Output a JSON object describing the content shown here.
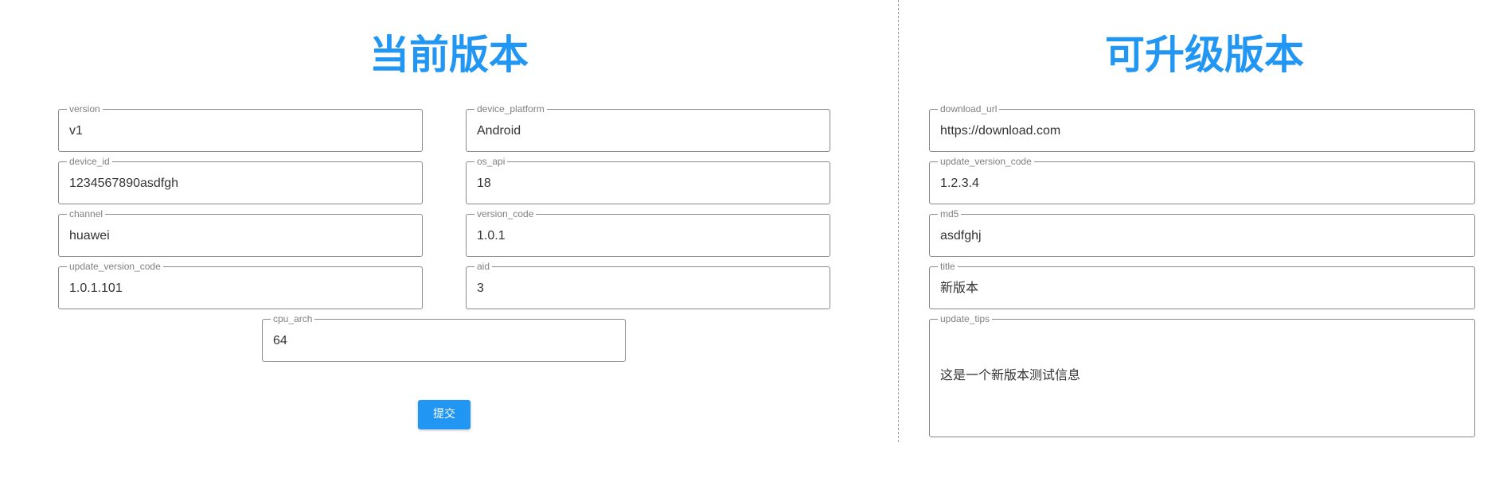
{
  "current": {
    "title": "当前版本",
    "fields": {
      "version": {
        "label": "version",
        "value": "v1"
      },
      "device_platform": {
        "label": "device_platform",
        "value": "Android"
      },
      "device_id": {
        "label": "device_id",
        "value": "1234567890asdfgh"
      },
      "os_api": {
        "label": "os_api",
        "value": "18"
      },
      "channel": {
        "label": "channel",
        "value": "huawei"
      },
      "version_code": {
        "label": "version_code",
        "value": "1.0.1"
      },
      "update_version_code": {
        "label": "update_version_code",
        "value": "1.0.1.101"
      },
      "aid": {
        "label": "aid",
        "value": "3"
      },
      "cpu_arch": {
        "label": "cpu_arch",
        "value": "64"
      }
    },
    "submit_label": "提交"
  },
  "upgrade": {
    "title": "可升级版本",
    "fields": {
      "download_url": {
        "label": "download_url",
        "value": "https://download.com"
      },
      "update_version_code": {
        "label": "update_version_code",
        "value": "1.2.3.4"
      },
      "md5": {
        "label": "md5",
        "value": "asdfghj"
      },
      "title": {
        "label": "title",
        "value": "新版本"
      },
      "update_tips": {
        "label": "update_tips",
        "value": "这是一个新版本测试信息"
      }
    }
  },
  "colors": {
    "accent": "#2196f3",
    "border": "#8a8a8a",
    "label": "#808080",
    "text": "#333333"
  }
}
